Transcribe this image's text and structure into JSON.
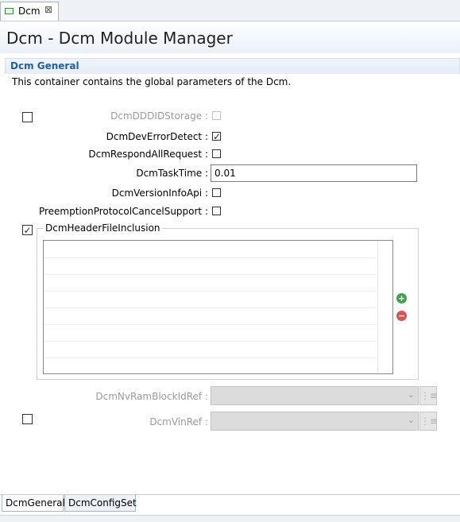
{
  "editor_tab": {
    "label": "Dcm",
    "close": "⊠"
  },
  "header": {
    "title": "Dcm - Dcm Module Manager"
  },
  "section": {
    "title": "Dcm General",
    "description": "This container contains the global parameters of the Dcm."
  },
  "params": {
    "dddid_storage": {
      "label": "DcmDDDIDStorage :",
      "checked": false
    },
    "dev_error_detect": {
      "label": "DcmDevErrorDetect :",
      "checked": true
    },
    "respond_all_request": {
      "label": "DcmRespondAllRequest :",
      "checked": false
    },
    "task_time": {
      "label": "DcmTaskTime :",
      "value": "0.01"
    },
    "version_info_api": {
      "label": "DcmVersionInfoApi :",
      "checked": false
    },
    "preemption_cancel": {
      "label": "PreemptionProtocolCancelSupport :",
      "checked": false
    }
  },
  "header_file_inclusion": {
    "label": "DcmHeaderFileInclusion",
    "enabled": true
  },
  "nvram_block_ref": {
    "label": "DcmNvRamBlockIdRef :",
    "value": ""
  },
  "vin_ref": {
    "label": "DcmVinRef :",
    "value": ""
  },
  "icons": {
    "check": "✓",
    "add": "+",
    "remove": "−",
    "dropdown": "⌄",
    "browse": "⋮≡"
  },
  "bottom_tabs": [
    {
      "label": "DcmGeneral",
      "active": true
    },
    {
      "label": "DcmConfigSet",
      "active": false
    }
  ],
  "colors": {
    "section_title": "#1f5fa6",
    "add": "#3fa34d",
    "remove": "#d9534f"
  }
}
